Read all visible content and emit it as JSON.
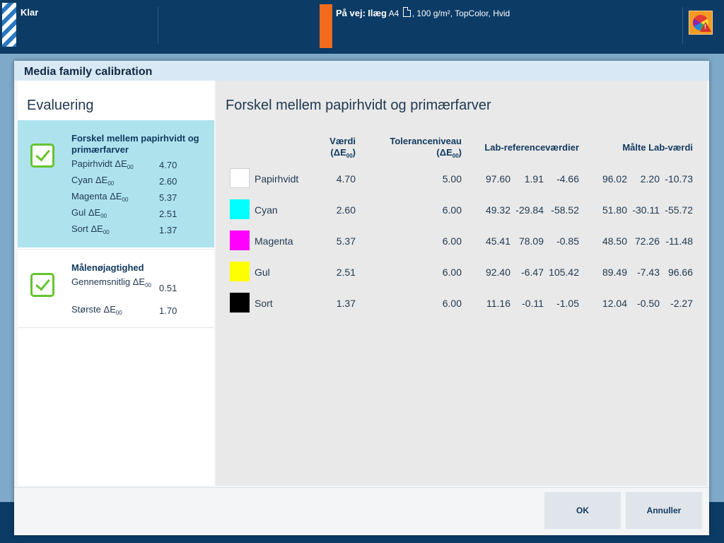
{
  "status_bar": {
    "status_label": "Klar",
    "job_prefix": "På vej:",
    "job_tray": "Ilæg",
    "job_size": "A4",
    "job_media": ", 100 g/m², TopColor, Hvid",
    "job_marker_color": "#f26b1d",
    "color_button_icon": "color-wheel-warning-icon"
  },
  "dialog": {
    "title": "Media family calibration",
    "left_panel": {
      "heading": "Evaluering",
      "cards": [
        {
          "title": "Forskel mellem papirhvidt og primærfarver",
          "status_icon": "checkmark-icon",
          "selected": true,
          "rows": [
            {
              "label": "Papirhvidt ΔE",
              "sub": "00",
              "value": "4.70"
            },
            {
              "label": "Cyan ΔE",
              "sub": "00",
              "value": "2.60"
            },
            {
              "label": "Magenta ΔE",
              "sub": "00",
              "value": "5.37"
            },
            {
              "label": "Gul ΔE",
              "sub": "00",
              "value": "2.51"
            },
            {
              "label": "Sort ΔE",
              "sub": "00",
              "value": "1.37"
            }
          ]
        },
        {
          "title": "Målenøjagtighed",
          "status_icon": "checkmark-icon",
          "selected": false,
          "rows": [
            {
              "label": "Gennemsnitlig ΔE",
              "sub": "00",
              "value": "0.51"
            },
            {
              "label": "Største ΔE",
              "sub": "00",
              "value": "1.70"
            }
          ]
        }
      ]
    },
    "right_panel": {
      "heading": "Forskel mellem papirhvidt og primærfarver",
      "columns": {
        "value_line1": "Værdi",
        "value_line2": "(ΔE",
        "value_sub": "00",
        "value_close": ")",
        "tolerance_line1": "Toleranceniveau",
        "tolerance_line2": "(ΔE",
        "tolerance_sub": "00",
        "tolerance_close": ")",
        "lab_reference": "Lab-referenceværdier",
        "lab_measured": "Målte Lab-værdi"
      },
      "rows": [
        {
          "name": "Papirhvidt",
          "swatch": "#ffffff",
          "value": "4.70",
          "tolerance": "5.00",
          "ref": [
            "97.60",
            "1.91",
            "-4.66"
          ],
          "measured": [
            "96.02",
            "2.20",
            "-10.73"
          ]
        },
        {
          "name": "Cyan",
          "swatch": "#00ffff",
          "value": "2.60",
          "tolerance": "6.00",
          "ref": [
            "49.32",
            "-29.84",
            "-58.52"
          ],
          "measured": [
            "51.80",
            "-30.11",
            "-55.72"
          ]
        },
        {
          "name": "Magenta",
          "swatch": "#ff00ff",
          "value": "5.37",
          "tolerance": "6.00",
          "ref": [
            "45.41",
            "78.09",
            "-0.85"
          ],
          "measured": [
            "48.50",
            "72.26",
            "-11.48"
          ]
        },
        {
          "name": "Gul",
          "swatch": "#ffff00",
          "value": "2.51",
          "tolerance": "6.00",
          "ref": [
            "92.40",
            "-6.47",
            "105.42"
          ],
          "measured": [
            "89.49",
            "-7.43",
            "96.66"
          ]
        },
        {
          "name": "Sort",
          "swatch": "#000000",
          "value": "1.37",
          "tolerance": "6.00",
          "ref": [
            "11.16",
            "-0.11",
            "-1.05"
          ],
          "measured": [
            "12.04",
            "-0.50",
            "-2.27"
          ]
        }
      ]
    },
    "buttons": {
      "ok": "OK",
      "cancel": "Annuller"
    }
  },
  "colors": {
    "status_bar_bg": "#0c3b66",
    "selected_card_bg": "#aee3ee",
    "check_green": "#65c430"
  }
}
